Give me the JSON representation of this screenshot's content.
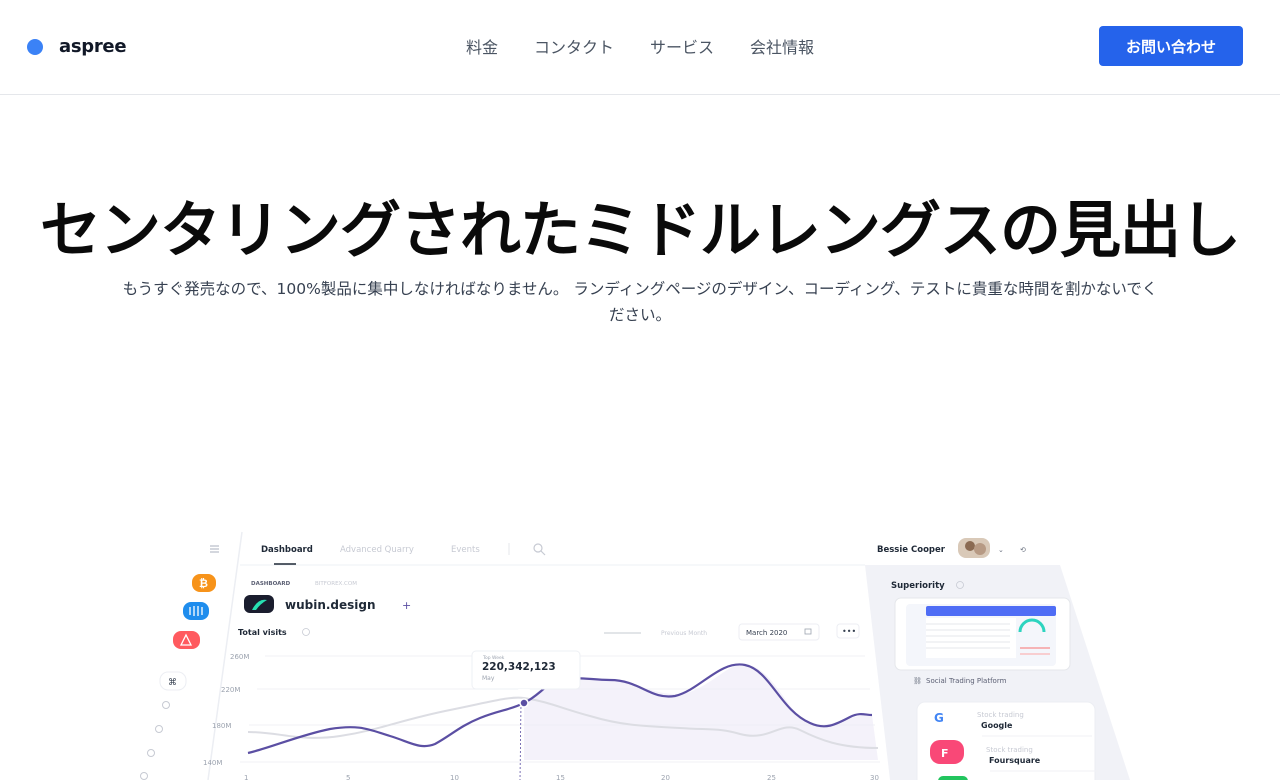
{
  "brand": {
    "name": "aspree",
    "color": "#3b82f6"
  },
  "nav": {
    "items": [
      {
        "label": "料金"
      },
      {
        "label": "コンタクト"
      },
      {
        "label": "サービス"
      },
      {
        "label": "会社情報"
      }
    ],
    "cta_label": "お問い合わせ"
  },
  "hero": {
    "title": "センタリングされたミドルレングスの見出し",
    "subtitle": "もうすぐ発売なので、100%製品に集中しなければなりません。 ランディングページのデザイン、コーディング、テストに貴重な時間を割かないでください。"
  },
  "dashboard": {
    "tabs": [
      "Dashboard",
      "Advanced Quarry",
      "Events"
    ],
    "user_name": "Bessie Cooper",
    "breadcrumb": [
      "DASHBOARD",
      "BITFOREX.COM"
    ],
    "project_name": "wubin.design",
    "chart_title": "Total visits",
    "legend_label": "Previous Month",
    "date_select": "March 2020",
    "tooltip_label": "Top Week",
    "tooltip_value": "220,342,123",
    "tooltip_month": "May",
    "y_ticks": [
      "260M",
      "220M",
      "180M",
      "140M"
    ],
    "x_ticks": [
      "1",
      "5",
      "10",
      "15",
      "20",
      "25",
      "30"
    ],
    "panel_title": "Superiority",
    "panel_link": "Social Trading Platform",
    "stocks": [
      {
        "caption": "Stock trading",
        "name": "Google"
      },
      {
        "caption": "Stock trading",
        "name": "Foursquare"
      }
    ],
    "colors": {
      "accent": "#5b4fa3",
      "bitcoin": "#f7931a",
      "intercom": "#1f8ded",
      "airbnb": "#ff5a5f"
    }
  }
}
